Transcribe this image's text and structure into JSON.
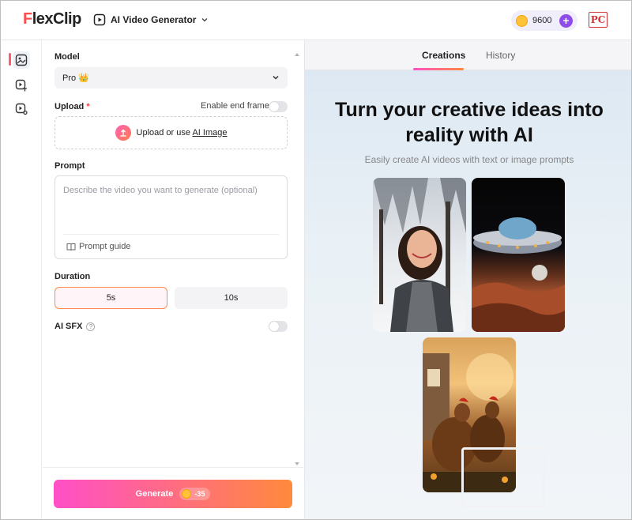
{
  "header": {
    "logo_text": "FlexClip",
    "logo_initial": "F",
    "logo_rest": "lexClip",
    "app_name": "AI Video Generator",
    "credits": "9600",
    "plus_label": "+",
    "badge_text": "PC"
  },
  "form": {
    "model_label": "Model",
    "model_value": "Pro 👑",
    "upload_label": "Upload",
    "required_mark": "*",
    "end_frame_label": "Enable end frame",
    "upload_prefix": "Upload or use ",
    "upload_link": "AI Image",
    "prompt_label": "Prompt",
    "prompt_placeholder": "Describe the video you want to generate (optional)",
    "prompt_guide": "Prompt guide",
    "duration_label": "Duration",
    "durations": [
      "5s",
      "10s"
    ],
    "selected_duration": "5s",
    "sfx_label": "AI SFX",
    "sfx_help": "?",
    "generate_label": "Generate",
    "generate_cost": "-35"
  },
  "right": {
    "tabs": [
      "Creations",
      "History"
    ],
    "active_tab": "Creations",
    "hero_title": "Turn your creative ideas into reality with AI",
    "hero_subtitle": "Easily create AI videos with text or image prompts"
  },
  "colors": {
    "accent_start": "#ff4fc8",
    "accent_end": "#ff8a3b",
    "purple": "#8e4de8",
    "logo_red": "#ff4d4d"
  }
}
